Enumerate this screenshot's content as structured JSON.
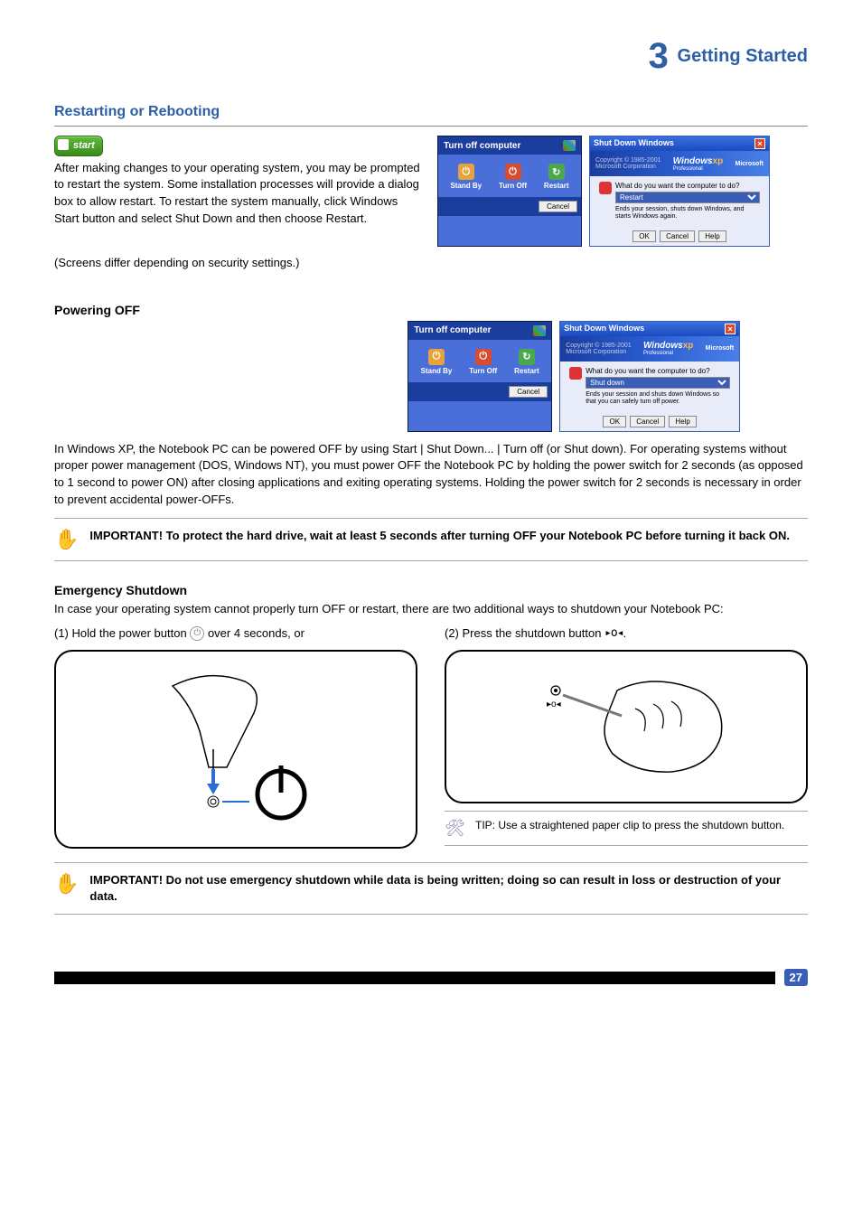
{
  "chapter": {
    "num": "3",
    "title": "Getting Started"
  },
  "restart": {
    "heading": "Restarting or Rebooting",
    "body": "After making changes to your operating system, you may be prompted to restart the system. Some installation processes will provide a dialog box to allow restart. To restart the system manually, click Windows Start button and select Shut Down and then choose Restart.",
    "dlg1_regions": "(Screens differ depending on security settings.)"
  },
  "poweroff": {
    "heading": "Powering OFF",
    "body": "In Windows XP, the Notebook PC can be powered OFF by using Start | Shut Down... | Turn off (or Shut down). For operating systems without proper power management (DOS, Windows NT), you must power OFF the Notebook PC by holding the power switch for 2 seconds (as opposed to 1 second to power ON) after closing applications and exiting operating systems. Holding the power switch for 2 seconds is necessary in order to prevent accidental power-OFFs.",
    "caution": "IMPORTANT! To protect the hard drive, wait at least 5 seconds after turning OFF your Notebook PC before turning it back ON."
  },
  "emerg": {
    "heading": "Emergency Shutdown",
    "lead": "In case your operating system cannot properly turn OFF or restart, there are two additional ways to shutdown your Notebook PC:",
    "opt1_a": "(1) Hold the power button",
    "opt1_b": " over 4 seconds, or",
    "opt2_a": "(2) Press the shutdown button",
    "opt2_b": ".",
    "tip": "TIP: Use a straightened paper clip to press the shutdown button.",
    "caution": "IMPORTANT! Do not use emergency shutdown while data is being written; doing so can result in loss or destruction of your data."
  },
  "turnoff_dialog": {
    "title": "Turn off computer",
    "standby": "Stand By",
    "turnoff": "Turn Off",
    "restart": "Restart",
    "cancel": "Cancel"
  },
  "shutdown_dialog": {
    "title": "Shut Down Windows",
    "brand": "Windows",
    "edition": "Professional",
    "brand_sub": "Microsoft",
    "question": "What do you want the computer to do?",
    "opt_restart": "Restart",
    "hint_restart": "Ends your session, shuts down Windows, and starts Windows again.",
    "opt_shutdown": "Shut down",
    "hint_shutdown": "Ends your session and shuts down Windows so that you can safely turn off power.",
    "ok": "OK",
    "cancel": "Cancel",
    "help": "Help"
  },
  "start_btn": "start",
  "footer": {
    "page": "27"
  }
}
